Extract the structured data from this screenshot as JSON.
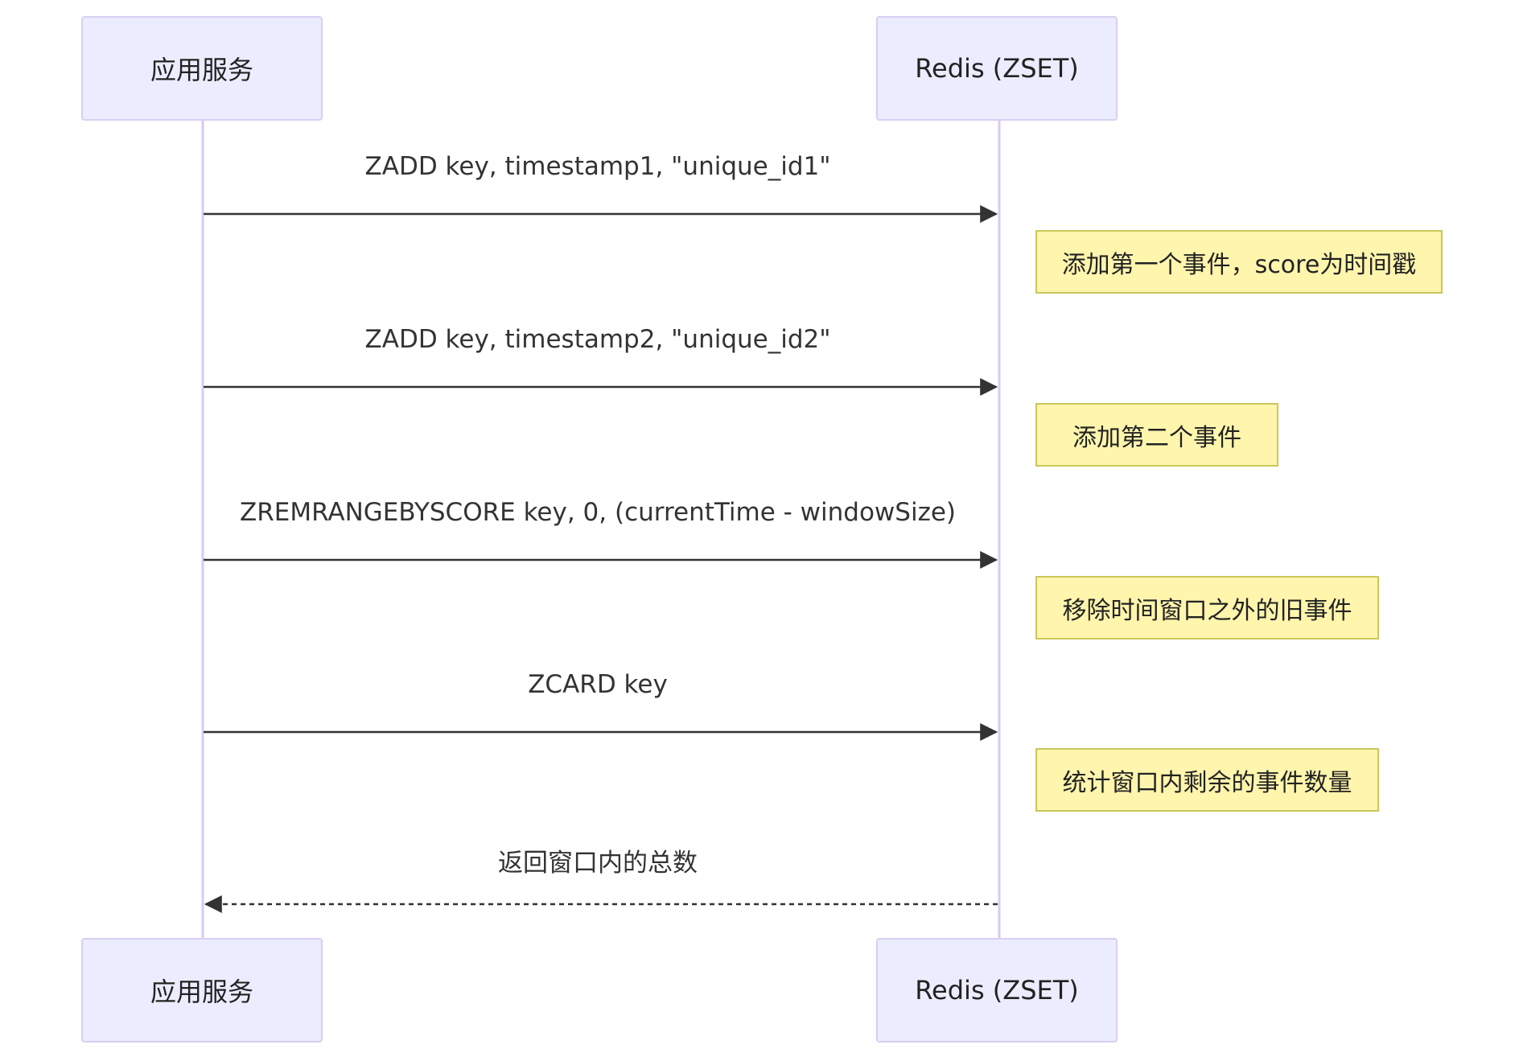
{
  "participants": {
    "app": {
      "label": "应用服务"
    },
    "redis": {
      "label": "Redis (ZSET)"
    }
  },
  "messages": [
    {
      "from": "app",
      "to": "redis",
      "label": "ZADD key, timestamp1, \"unique_id1\"",
      "style": "solid"
    },
    {
      "from": "app",
      "to": "redis",
      "label": "ZADD key, timestamp2, \"unique_id2\"",
      "style": "solid"
    },
    {
      "from": "app",
      "to": "redis",
      "label": "ZREMRANGEBYSCORE key, 0, (currentTime - windowSize)",
      "style": "solid"
    },
    {
      "from": "app",
      "to": "redis",
      "label": "ZCARD key",
      "style": "solid"
    },
    {
      "from": "redis",
      "to": "app",
      "label": "返回窗口内的总数",
      "style": "dashed"
    }
  ],
  "notes": [
    {
      "side": "right of redis",
      "text": "添加第一个事件，score为时间戳"
    },
    {
      "side": "right of redis",
      "text": "添加第二个事件"
    },
    {
      "side": "right of redis",
      "text": "移除时间窗口之外的旧事件"
    },
    {
      "side": "right of redis",
      "text": "统计窗口内剩余的事件数量"
    }
  ],
  "colors": {
    "actor_fill": "#ececff",
    "actor_border": "#d7cff0",
    "lifeline": "#d9c9f5",
    "arrow": "#333333",
    "note_fill": "#fff5ad",
    "note_border": "#c8c85a"
  }
}
